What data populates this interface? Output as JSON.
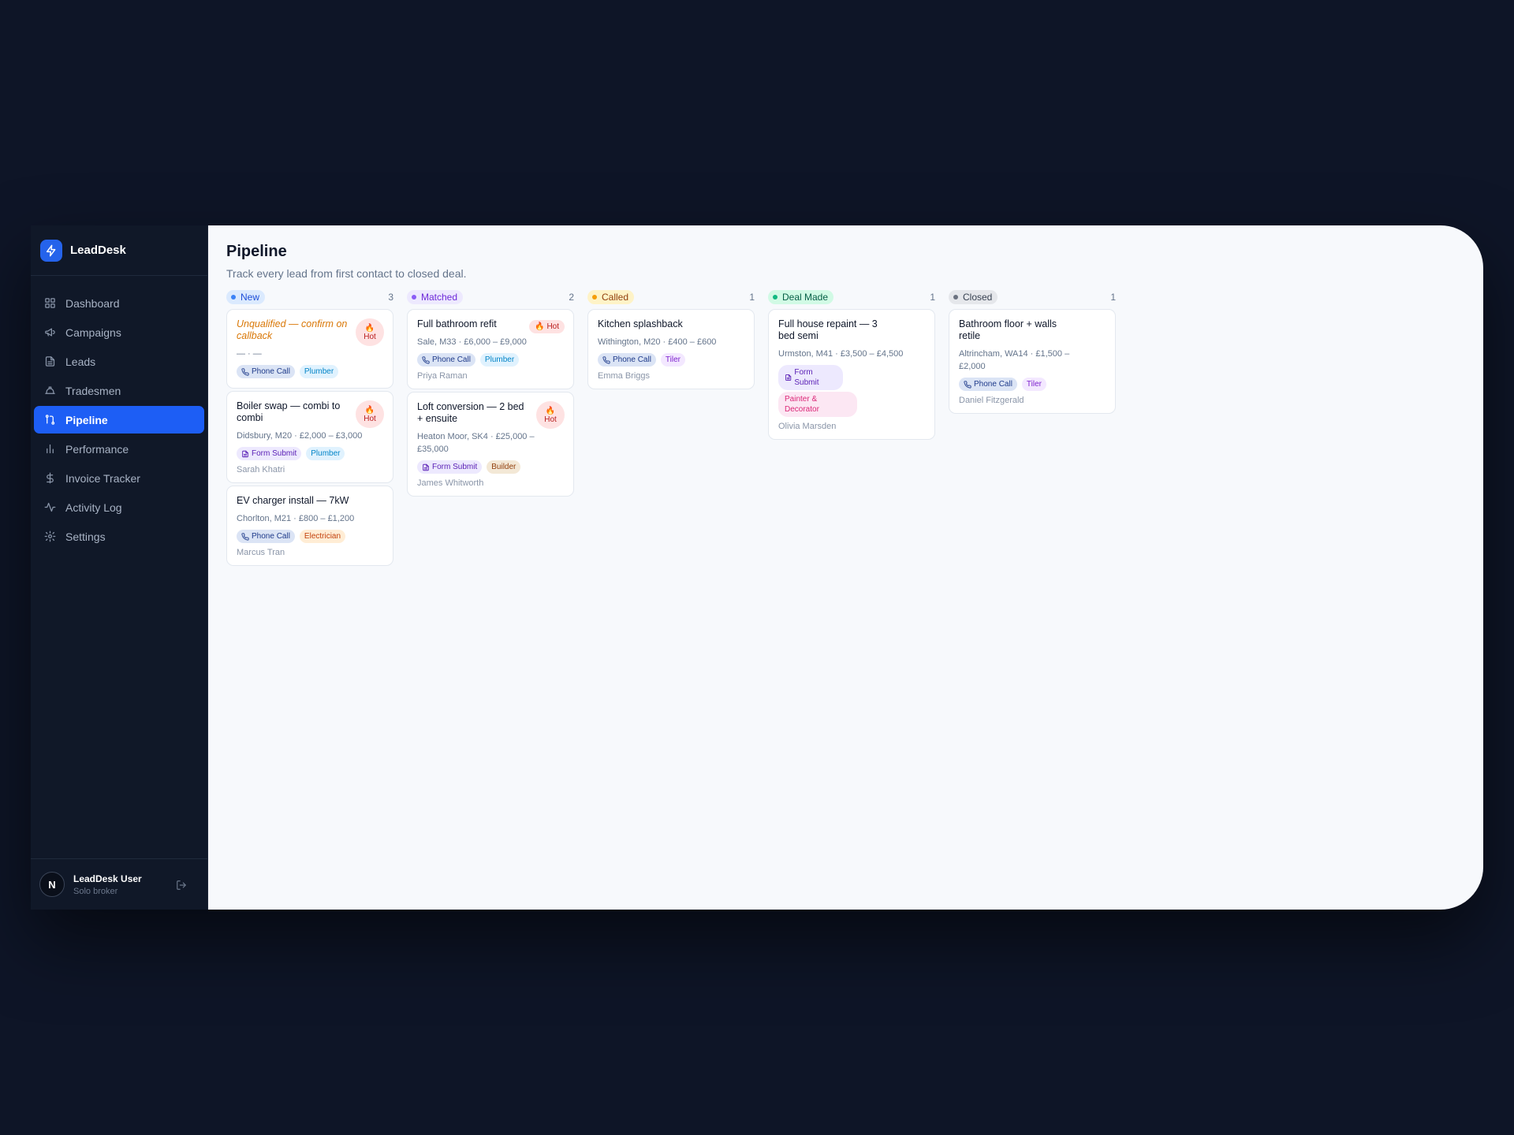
{
  "app": {
    "name": "LeadDesk"
  },
  "nav": [
    {
      "label": "Dashboard",
      "icon": "grid-icon",
      "active": false
    },
    {
      "label": "Campaigns",
      "icon": "megaphone-icon",
      "active": false
    },
    {
      "label": "Leads",
      "icon": "document-icon",
      "active": false
    },
    {
      "label": "Tradesmen",
      "icon": "hard-hat-icon",
      "active": false
    },
    {
      "label": "Pipeline",
      "icon": "pipeline-icon",
      "active": true
    },
    {
      "label": "Performance",
      "icon": "bar-chart-icon",
      "active": false
    },
    {
      "label": "Invoice Tracker",
      "icon": "dollar-icon",
      "active": false
    },
    {
      "label": "Activity Log",
      "icon": "activity-icon",
      "active": false
    },
    {
      "label": "Settings",
      "icon": "gear-icon",
      "active": false
    }
  ],
  "user": {
    "initial": "N",
    "name": "LeadDesk User",
    "role": "Solo broker"
  },
  "page": {
    "title": "Pipeline",
    "subtitle": "Track every lead from first contact to closed deal."
  },
  "hot_label": "Hot",
  "columns": [
    {
      "name": "New",
      "count": "3",
      "bg": "#dbeafe",
      "fg": "#1d4ed8",
      "dot": "#3b82f6",
      "cards": [
        {
          "title": "Unqualified — confirm on callback",
          "unqualified": true,
          "meta": "— · —",
          "hot": "stacked",
          "tags": [
            {
              "label": "Phone Call",
              "type": "channel-phone"
            },
            {
              "label": "Plumber",
              "type": "plumber"
            }
          ],
          "person": ""
        },
        {
          "title": "Boiler swap — combi to combi",
          "meta": "Didsbury, M20 · £2,000 – £3,000",
          "hot": "stacked",
          "tags": [
            {
              "label": "Form Submit",
              "type": "channel-form"
            },
            {
              "label": "Plumber",
              "type": "plumber"
            }
          ],
          "person": "Sarah Khatri"
        },
        {
          "title": "EV charger install — 7kW",
          "meta": "Chorlton, M21 · £800 – £1,200",
          "hot": "",
          "tags": [
            {
              "label": "Phone Call",
              "type": "channel-phone"
            },
            {
              "label": "Electrician",
              "type": "electrician"
            }
          ],
          "person": "Marcus Tran"
        }
      ]
    },
    {
      "name": "Matched",
      "count": "2",
      "bg": "#ede9fe",
      "fg": "#6d28d9",
      "dot": "#8b5cf6",
      "cards": [
        {
          "title": "Full bathroom refit",
          "meta": "Sale, M33 · £6,000 – £9,000",
          "hot": "inline",
          "tags": [
            {
              "label": "Phone Call",
              "type": "channel-phone"
            },
            {
              "label": "Plumber",
              "type": "plumber"
            }
          ],
          "person": "Priya Raman"
        },
        {
          "title": "Loft conversion — 2 bed + ensuite",
          "meta": "Heaton Moor, SK4 · £25,000 – £35,000",
          "hot": "stacked",
          "tags": [
            {
              "label": "Form Submit",
              "type": "channel-form"
            },
            {
              "label": "Builder",
              "type": "builder"
            }
          ],
          "person": "James Whitworth"
        }
      ]
    },
    {
      "name": "Called",
      "count": "1",
      "bg": "#fef3c7",
      "fg": "#92400e",
      "dot": "#f59e0b",
      "cards": [
        {
          "title": "Kitchen splashback",
          "meta": "Withington, M20 · £400 – £600",
          "hot": "",
          "tags": [
            {
              "label": "Phone Call",
              "type": "channel-phone"
            },
            {
              "label": "Tiler",
              "type": "tiler"
            }
          ],
          "person": "Emma Briggs"
        }
      ]
    },
    {
      "name": "Deal Made",
      "count": "1",
      "bg": "#d1fae5",
      "fg": "#065f46",
      "dot": "#10b981",
      "cards": [
        {
          "title": "Full house repaint — 3 bed semi",
          "meta": "Urmston, M41 · £3,500 – £4,500",
          "hot": "",
          "tags": [
            {
              "label": "Form Submit",
              "type": "channel-form",
              "two_line": true
            },
            {
              "label": "Painter & Decorator",
              "type": "painter",
              "two_line": true
            }
          ],
          "person": "Olivia Marsden"
        }
      ]
    },
    {
      "name": "Closed",
      "count": "1",
      "bg": "#e5e7eb",
      "fg": "#374151",
      "dot": "#6b7280",
      "cards": [
        {
          "title": "Bathroom floor + walls retile",
          "meta": "Altrincham, WA14 · £1,500 – £2,000",
          "hot": "",
          "tags": [
            {
              "label": "Phone Call",
              "type": "channel-phone"
            },
            {
              "label": "Tiler",
              "type": "tiler"
            }
          ],
          "person": "Daniel Fitzgerald"
        }
      ]
    }
  ],
  "tag_colors": {
    "channel-phone": {
      "bg": "#dbe4f5",
      "fg": "#1e3a8a"
    },
    "channel-form": {
      "bg": "#ede9fe",
      "fg": "#5b21b6"
    },
    "plumber": {
      "bg": "#e0f2fe",
      "fg": "#0284c7"
    },
    "electrician": {
      "bg": "#ffedd5",
      "fg": "#c2410c"
    },
    "builder": {
      "bg": "#f3e8d6",
      "fg": "#92400e"
    },
    "tiler": {
      "bg": "#f3e8ff",
      "fg": "#7e22ce"
    },
    "painter": {
      "bg": "#fce7f3",
      "fg": "#db2777"
    }
  }
}
